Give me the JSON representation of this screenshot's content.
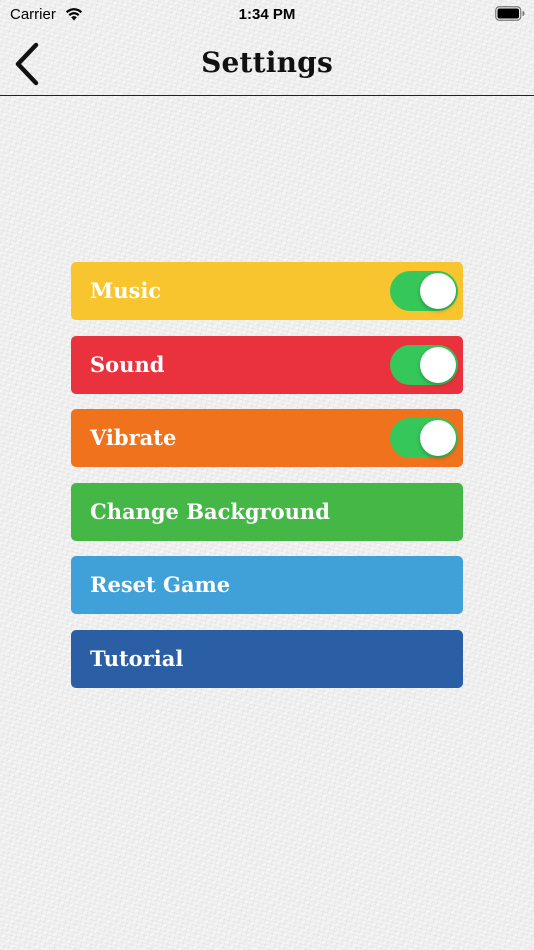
{
  "status_bar": {
    "carrier": "Carrier",
    "time": "1:34 PM",
    "wifi_icon": "wifi-icon",
    "battery_icon": "battery-icon"
  },
  "nav": {
    "title": "Settings",
    "back_icon": "chevron-left-icon"
  },
  "settings": [
    {
      "label": "Music",
      "color": "#f9c52e",
      "toggle": true,
      "on": true
    },
    {
      "label": "Sound",
      "color": "#e9323e",
      "toggle": true,
      "on": true
    },
    {
      "label": "Vibrate",
      "color": "#f0721d",
      "toggle": true,
      "on": true
    },
    {
      "label": "Change Background",
      "color": "#44b746",
      "toggle": false
    },
    {
      "label": "Reset Game",
      "color": "#40a0d8",
      "toggle": false
    },
    {
      "label": "Tutorial",
      "color": "#2a5fa5",
      "toggle": false
    }
  ],
  "colors": {
    "toggle_on": "#35c759"
  }
}
